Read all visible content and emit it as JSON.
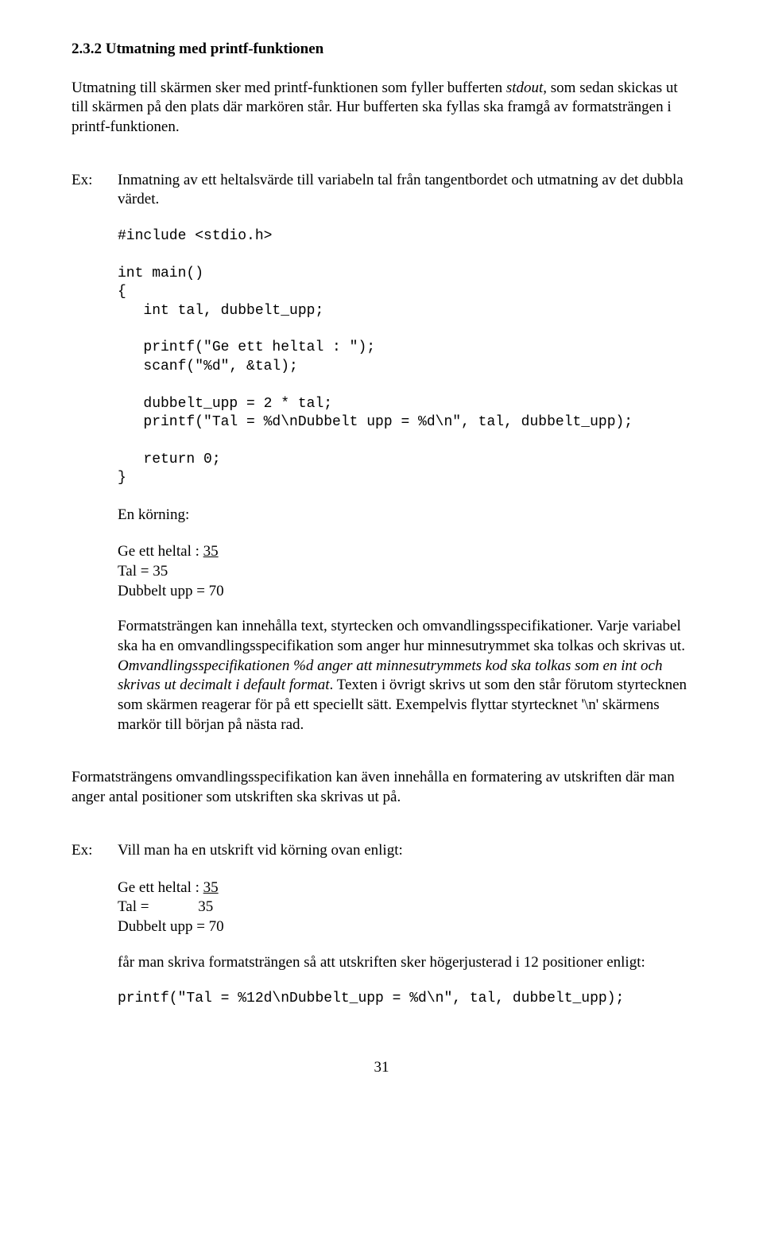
{
  "heading": "2.3.2 Utmatning med printf-funktionen",
  "para1": "Utmatning till skärmen sker med printf-funktionen som fyller bufferten stdout, som sedan skickas ut till skärmen på den plats där markören står. Hur bufferten ska fyllas ska framgå av formatsträngen i printf-funktionen.",
  "ex_label": "Ex:",
  "ex1_intro": "Inmatning av ett heltalsvärde till variabeln tal från tangentbordet och utmatning av det dubbla värdet.",
  "code1": "#include <stdio.h>\n\nint main()\n{\n   int tal, dubbelt_upp;\n\n   printf(\"Ge ett heltal : \");\n   scanf(\"%d\", &tal);\n\n   dubbelt_upp = 2 * tal;\n   printf(\"Tal = %d\\nDubbelt upp = %d\\n\", tal, dubbelt_upp);\n\n   return 0;\n}",
  "run_label": "En körning:",
  "run1_line1a": "Ge ett heltal : ",
  "run1_line1b": "35",
  "run1_line2": "Tal = 35",
  "run1_line3": "Dubbelt upp = 70",
  "para2a": "Formatsträngen kan innehålla text, styrtecken och omvandlingsspecifikationer. Varje variabel ska ha en omvandlingsspecifikation som anger hur minnesutrymmet ska tolkas och skrivas ut. ",
  "para2b": "Omvandlingsspecifikationen %d anger att minnesutrymmets kod ska tolkas som en int  och skrivas ut decimalt  i default format",
  "para2c": ". Texten i övrigt skrivs ut som den står förutom styrtecknen som skärmen reagerar för på ett speciellt sätt. Exempelvis flyttar styrtecknet '\\n' skärmens markör till början på nästa rad.",
  "para3": "Formatsträngens omvandlingsspecifikation kan även innehålla en formatering av utskriften där man anger antal positioner som utskriften ska skrivas ut på.",
  "ex2_intro": "Vill man ha en utskrift vid körning ovan enligt:",
  "run2_line1a": "Ge ett heltal :  ",
  "run2_line1b": "35",
  "run2_line2": "Tal =             35",
  "run2_line3": "Dubbelt upp = 70",
  "ex2_after": "får man skriva formatsträngen så att utskriften sker högerjusterad i 12 positioner enligt:",
  "code2": "printf(\"Tal = %12d\\nDubbelt_upp = %d\\n\", tal, dubbelt_upp);",
  "page_number": "31"
}
